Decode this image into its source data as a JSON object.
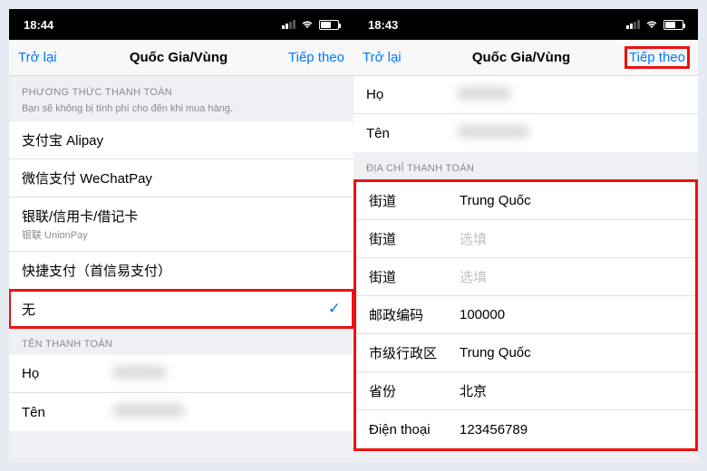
{
  "left": {
    "status_time": "18:44",
    "nav": {
      "back": "Trở lại",
      "title": "Quốc Gia/Vùng",
      "next": "Tiếp theo"
    },
    "payment_header": "PHƯƠNG THỨC THANH TOÁN",
    "payment_sub": "Bạn sẽ không bị tính phí cho đến khi mua hàng.",
    "payment_methods": [
      {
        "label": "支付宝 Alipay",
        "sub": ""
      },
      {
        "label": "微信支付 WeChatPay",
        "sub": ""
      },
      {
        "label": "银联/信用卡/借记卡",
        "sub": "银联 UnionPay"
      },
      {
        "label": "快捷支付（首信易支付）",
        "sub": ""
      },
      {
        "label": "无",
        "sub": "",
        "selected": true
      }
    ],
    "billing_name_header": "TÊN THANH TOÁN",
    "name_fields": [
      {
        "label": "Họ"
      },
      {
        "label": "Tên"
      }
    ]
  },
  "right": {
    "status_time": "18:43",
    "nav": {
      "back": "Trở lại",
      "title": "Quốc Gia/Vùng",
      "next": "Tiếp theo"
    },
    "name_fields": [
      {
        "label": "Họ"
      },
      {
        "label": "Tên"
      }
    ],
    "billing_address_header": "ĐỊA CHỈ THANH TOÁN",
    "address_fields": [
      {
        "label": "街道",
        "value": "Trung Quốc"
      },
      {
        "label": "街道",
        "value": "",
        "placeholder": "选填"
      },
      {
        "label": "街道",
        "value": "",
        "placeholder": "选填"
      },
      {
        "label": "邮政编码",
        "value": "100000"
      },
      {
        "label": "市级行政区",
        "value": "Trung Quốc"
      },
      {
        "label": "省份",
        "value": "北京"
      },
      {
        "label": "Điện thoại",
        "value": "123456789"
      }
    ]
  }
}
